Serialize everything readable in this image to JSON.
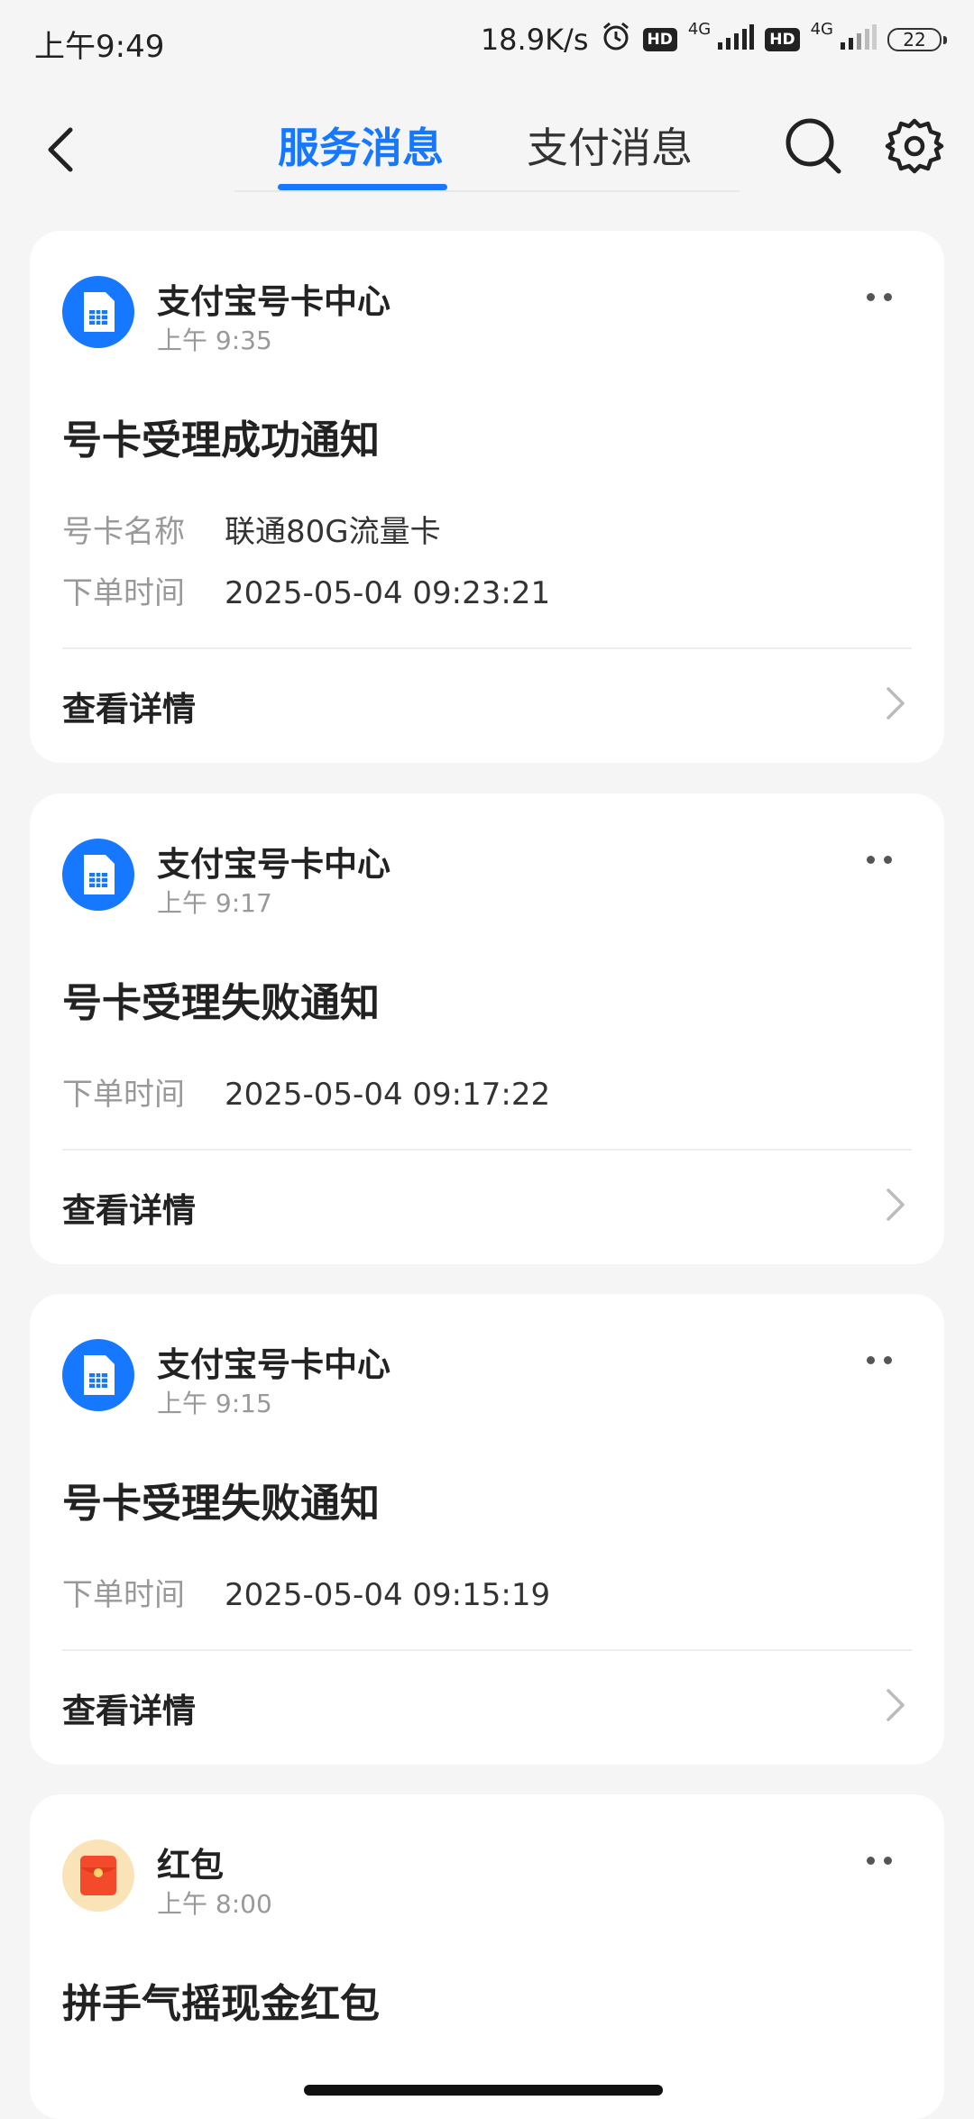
{
  "status_bar": {
    "time": "上午9:49",
    "speed": "18.9K/s",
    "hd1": "HD",
    "net1": "4G",
    "hd2": "HD",
    "net2": "4G",
    "battery": "22"
  },
  "header": {
    "tabs": [
      {
        "label": "服务消息",
        "active": true
      },
      {
        "label": "支付消息",
        "active": false
      }
    ],
    "accent_color": "#1677ff"
  },
  "messages": [
    {
      "sender": "支付宝号卡中心",
      "time": "上午 9:35",
      "title": "号卡受理成功通知",
      "fields": [
        {
          "label": "号卡名称",
          "value": "联通80G流量卡"
        },
        {
          "label": "下单时间",
          "value": "2025-05-04 09:23:21"
        }
      ],
      "detail": "查看详情",
      "icon": "sim-card-icon"
    },
    {
      "sender": "支付宝号卡中心",
      "time": "上午 9:17",
      "title": "号卡受理失败通知",
      "fields": [
        {
          "label": "下单时间",
          "value": "2025-05-04 09:17:22"
        }
      ],
      "detail": "查看详情",
      "icon": "sim-card-icon"
    },
    {
      "sender": "支付宝号卡中心",
      "time": "上午 9:15",
      "title": "号卡受理失败通知",
      "fields": [
        {
          "label": "下单时间",
          "value": "2025-05-04 09:15:19"
        }
      ],
      "detail": "查看详情",
      "icon": "sim-card-icon"
    },
    {
      "sender": "红包",
      "time": "上午 8:00",
      "title": "拼手气摇现金红包",
      "icon": "red-envelope-icon"
    }
  ]
}
